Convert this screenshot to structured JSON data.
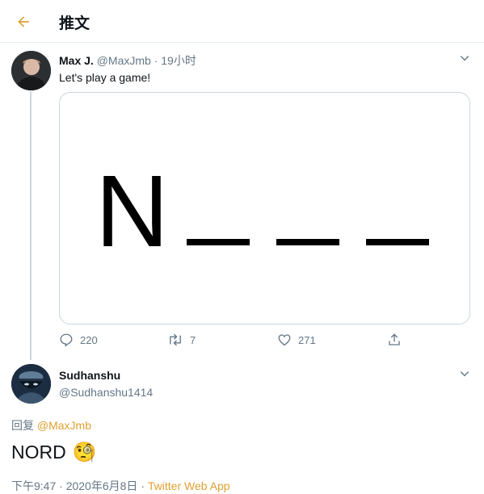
{
  "header": {
    "title": "推文"
  },
  "tweet": {
    "author_name": "Max J.",
    "author_handle": "@MaxJmb",
    "separator": "·",
    "time_ago": "19小时",
    "text": "Let's play a game!",
    "image": {
      "letter": "N"
    },
    "actions": {
      "reply_count": "220",
      "retweet_count": "7",
      "like_count": "271"
    }
  },
  "reply": {
    "author_name": "Sudhanshu",
    "author_handle": "@Sudhanshu1414",
    "replying_label": "回复",
    "replying_to": "@MaxJmb",
    "text": "NORD",
    "emoji": "🧐",
    "time": "下午9:47",
    "date": "2020年6月8日",
    "separator": "·",
    "source": "Twitter Web App"
  },
  "colors": {
    "accent": "#e0a030",
    "muted": "#657786",
    "border": "#ccd6dd"
  },
  "icons": [
    "back-arrow-icon",
    "chevron-down-icon",
    "reply-icon",
    "retweet-icon",
    "like-icon",
    "share-icon"
  ]
}
